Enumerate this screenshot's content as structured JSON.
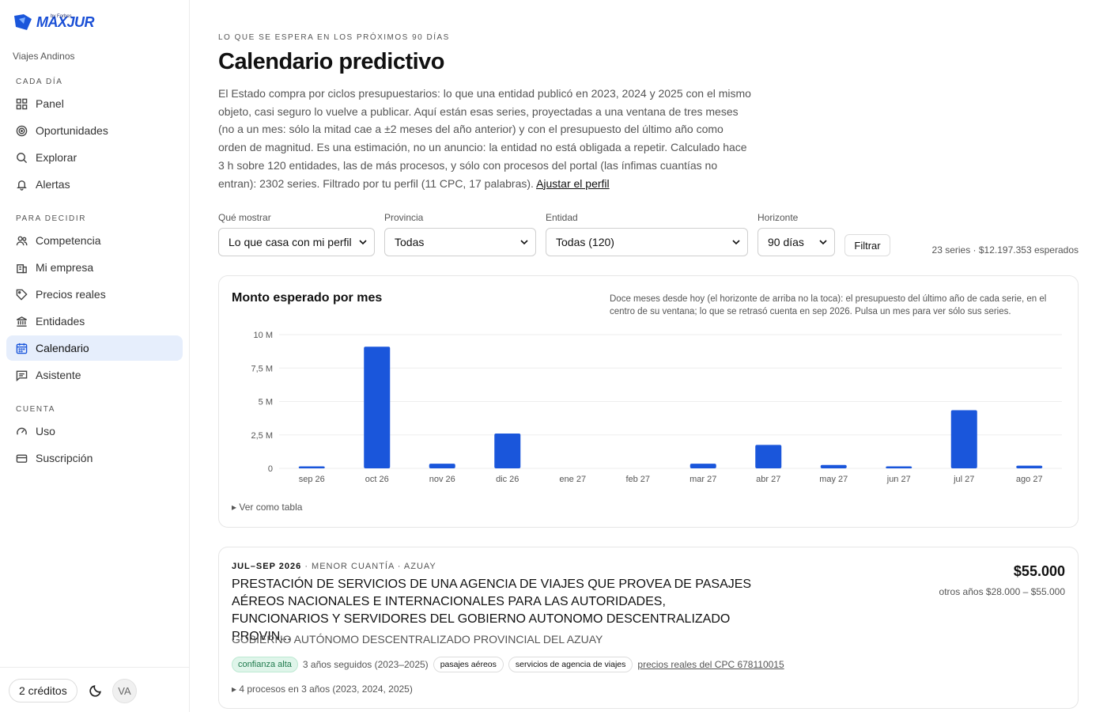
{
  "sidebar": {
    "logo": "MAXJUR",
    "logo_sub": "by Forbes",
    "org": "Viajes Andinos",
    "sections": [
      {
        "label": "CADA DÍA",
        "items": [
          {
            "label": "Panel",
            "icon": "grid-icon"
          },
          {
            "label": "Oportunidades",
            "icon": "target-icon"
          },
          {
            "label": "Explorar",
            "icon": "search-icon"
          },
          {
            "label": "Alertas",
            "icon": "bell-icon"
          }
        ]
      },
      {
        "label": "PARA DECIDIR",
        "items": [
          {
            "label": "Competencia",
            "icon": "users-icon"
          },
          {
            "label": "Mi empresa",
            "icon": "building-icon"
          },
          {
            "label": "Precios reales",
            "icon": "tag-icon"
          },
          {
            "label": "Entidades",
            "icon": "bank-icon"
          },
          {
            "label": "Calendario",
            "icon": "calendar-icon",
            "active": true
          },
          {
            "label": "Asistente",
            "icon": "chat-icon"
          }
        ]
      },
      {
        "label": "CUENTA",
        "items": [
          {
            "label": "Uso",
            "icon": "gauge-icon"
          },
          {
            "label": "Suscripción",
            "icon": "card-icon"
          }
        ]
      }
    ],
    "credits": "2 créditos",
    "avatar": "VA"
  },
  "header": {
    "eyebrow": "LO QUE SE ESPERA EN LOS PRÓXIMOS 90 DÍAS",
    "title": "Calendario predictivo",
    "intro": "El Estado compra por ciclos presupuestarios: lo que una entidad publicó en 2023, 2024 y 2025 con el mismo objeto, casi seguro lo vuelve a publicar. Aquí están esas series, proyectadas a una ventana de tres meses (no a un mes: sólo la mitad cae a ±2 meses del año anterior) y con el presupuesto del último año como orden de magnitud. Es una estimación, no un anuncio: la entidad no está obligada a repetir. Calculado hace 3 h sobre 120 entidades, las de más procesos, y sólo con procesos del portal (las ínfimas cuantías no entran): 2302 series. Filtrado por tu perfil (11 CPC, 17 palabras).",
    "intro_link": "Ajustar el perfil"
  },
  "filters": {
    "show_label": "Qué mostrar",
    "show_value": "Lo que casa con mi perfil",
    "province_label": "Provincia",
    "province_value": "Todas",
    "entity_label": "Entidad",
    "entity_value": "Todas (120)",
    "horizon_label": "Horizonte",
    "horizon_value": "90 días",
    "submit": "Filtrar",
    "summary": "23 series · $12.197.353 esperados"
  },
  "chart_card": {
    "title": "Monto esperado por mes",
    "note": "Doce meses desde hoy (el horizonte de arriba no la toca): el presupuesto del último año de cada serie, en el centro de su ventana; lo que se retrasó cuenta en sep 2026. Pulsa un mes para ver sólo sus series.",
    "table_toggle": "▸ Ver como tabla"
  },
  "chart_data": {
    "type": "bar",
    "categories": [
      "sep 26",
      "oct 26",
      "nov 26",
      "dic 26",
      "ene 27",
      "feb 27",
      "mar 27",
      "abr 27",
      "may 27",
      "jun 27",
      "jul 27",
      "ago 27"
    ],
    "values": [
      150000,
      9100000,
      350000,
      2600000,
      0,
      0,
      350000,
      1750000,
      250000,
      150000,
      4350000,
      200000
    ],
    "yticks": [
      0,
      2500000,
      5000000,
      7500000,
      10000000
    ],
    "ytick_labels": [
      "0",
      "2,5 M",
      "5 M",
      "7,5 M",
      "10 M"
    ],
    "ylim": [
      0,
      10000000
    ],
    "bar_color": "#1a56db",
    "grid": true
  },
  "item": {
    "period": "JUL–SEP 2026",
    "type": "· MENOR CUANTÍA",
    "province": "· AZUAY",
    "title": "PRESTACIÓN DE SERVICIOS DE UNA AGENCIA DE VIAJES QUE PROVEA DE PASAJES AÉREOS NACIONALES E INTERNACIONALES PARA LAS AUTORIDADES, FUNCIONARIOS Y SERVIDORES DEL GOBIERNO AUTONOMO DESCENTRALIZADO PROVIN...",
    "entity": "GOBIERNO AUTÓNOMO DESCENTRALIZADO PROVINCIAL DEL AZUAY",
    "price": "$55.000",
    "range": "otros años $28.000 – $55.000",
    "confidence": "confianza alta",
    "years": "3 años seguidos (2023–2025)",
    "tag1": "pasajes aéreos",
    "tag2": "servicios de agencia de viajes",
    "cpc_link": "precios reales del CPC 678110015",
    "processes": "▸ 4 procesos en 3 años (2023, 2024, 2025)"
  }
}
